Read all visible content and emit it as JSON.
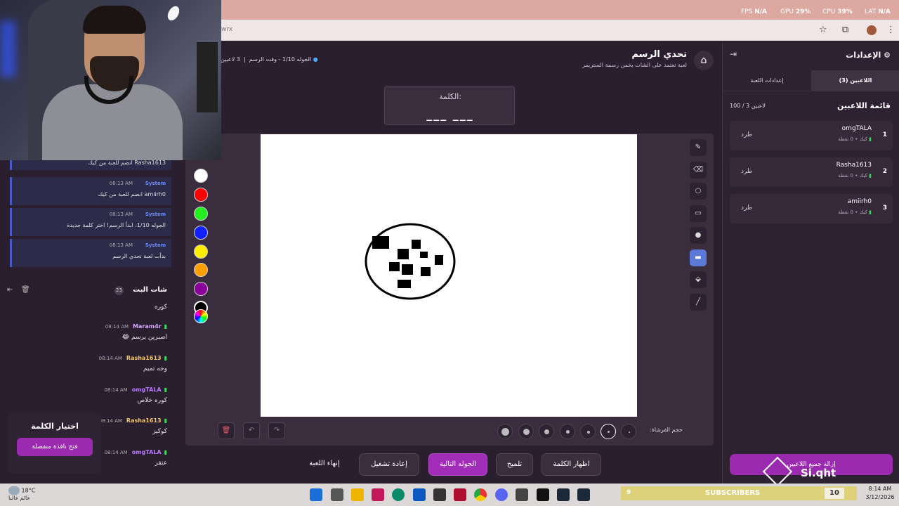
{
  "perf": {
    "fps_label": "FPS",
    "fps": "N/A",
    "gpu_label": "GPU",
    "gpu": "29%",
    "cpu_label": "CPU",
    "cpu": "39%",
    "lat_label": "LAT",
    "lat": "N/A"
  },
  "browser": {
    "url_fragment": "wrx"
  },
  "header": {
    "title": "تحدي الرسم",
    "subtitle": "لعبة تعتمد على الشات يخمن رسمة الستريمر",
    "stats": "الجوله 1/10 - وقت الرسم",
    "players": "3 لاعبين"
  },
  "word": {
    "label": "الكلمة:",
    "blanks": "___ ___"
  },
  "system_messages": [
    {
      "top": "Rasha1613 انضم للعبة من كيك"
    },
    {
      "who": "System",
      "time": "08:13 AM",
      "text": "amiirh0 انضم للعبة من كيك"
    },
    {
      "who": "System",
      "time": "08:13 AM",
      "text": "الجوله 1/10، ابدأ الرسم! اختر كلمة جديدة"
    },
    {
      "who": "System",
      "time": "08:13 AM",
      "text": "بدأت لعبة تحدي الرسم"
    }
  ],
  "chat": {
    "title": "شات البث",
    "count": "23",
    "first_text": "كوره",
    "messages": [
      {
        "name": "Maram4r",
        "color": "#d9a7ff",
        "time": "08:14 AM",
        "text": "اصبرين يرسم 😂"
      },
      {
        "name": "Rasha1613",
        "color": "#f0c46a",
        "time": "08:14 AM",
        "text": "وجه تميم"
      },
      {
        "name": "omgTALA",
        "color": "#b779ff",
        "time": "08:14 AM",
        "text": "كوره خلاص"
      },
      {
        "name": "Rasha1613",
        "color": "#f0c46a",
        "time": "08:14 AM",
        "text": "كوكيز"
      },
      {
        "name": "omgTALA",
        "color": "#b779ff",
        "time": "08:14 AM",
        "text": "عنقز"
      }
    ]
  },
  "word_picker": {
    "title": "اختيار الكلمة",
    "button": "فتح نافذة منفصلة"
  },
  "palette": [
    "#ffffff",
    "#ff0000",
    "#22ee22",
    "#1122ff",
    "#ffee00",
    "#ffa000",
    "#880099",
    "#000000"
  ],
  "brush": {
    "label": "حجم الفرشاة:"
  },
  "actions": {
    "reveal": "اظهار الكلمة",
    "hint": "تلميح",
    "next": "الجوله التالية",
    "restart": "إعادة تشغيل",
    "end": "إنهاء اللعبة"
  },
  "right_panel": {
    "title": "الإعدادات",
    "tab_players": "اللاعبين (3)",
    "tab_game": "إعدادات اللعبة",
    "list_title": "قائمة اللاعبين",
    "list_count": "100 / 3 لاعبين",
    "players": [
      {
        "rank": "1",
        "name": "omgTALA",
        "meta": "كيك • 0 نقطة",
        "kick": "طرد"
      },
      {
        "rank": "2",
        "name": "Rasha1613",
        "meta": "كيك • 0 نقطة",
        "kick": "طرد"
      },
      {
        "rank": "3",
        "name": "amiirh0",
        "meta": "كيك • 0 نقطة",
        "kick": "طرد"
      }
    ],
    "remove_all": "إزالة جميع اللاعبين"
  },
  "watermark": "Si.qht",
  "taskbar": {
    "temp": "18°C",
    "weather": "غائم غالبا",
    "subs_count": "9",
    "subs_label": "SUBSCRIBERS",
    "subs_goal": "10",
    "time": "8:14 AM",
    "date": "3/12/2026"
  }
}
